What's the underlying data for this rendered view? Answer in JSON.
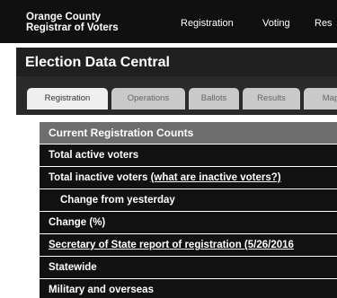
{
  "header": {
    "org_line1": "Orange County",
    "org_line2": "Registrar of Voters",
    "nav": [
      "Registration",
      "Voting",
      "Res"
    ]
  },
  "page_title": "Election Data Central",
  "tabs": [
    {
      "label": "Registration",
      "active": true
    },
    {
      "label": "Operations",
      "active": false
    },
    {
      "label": "Ballots",
      "active": false
    },
    {
      "label": "Results",
      "active": false
    },
    {
      "label": "Map",
      "active": false
    }
  ],
  "table": {
    "header": "Current Registration Counts",
    "total_active": "Total active voters",
    "total_inactive": "Total inactive voters",
    "inactive_link": "(what are inactive voters?)",
    "change_yesterday": "Change from yesterday",
    "change_pct": "Change (%)",
    "sos_report": "Secretary of State report of registration (5/26/2016",
    "statewide": "Statewide",
    "military": "Military and overseas"
  },
  "colors": {
    "topbar_bg": "#101010",
    "tab_active_bg": "#efefef",
    "tab_inactive_bg": "#c9c9c9",
    "table_header_bg": "#6e6e6e",
    "row_bg": "#111111"
  }
}
